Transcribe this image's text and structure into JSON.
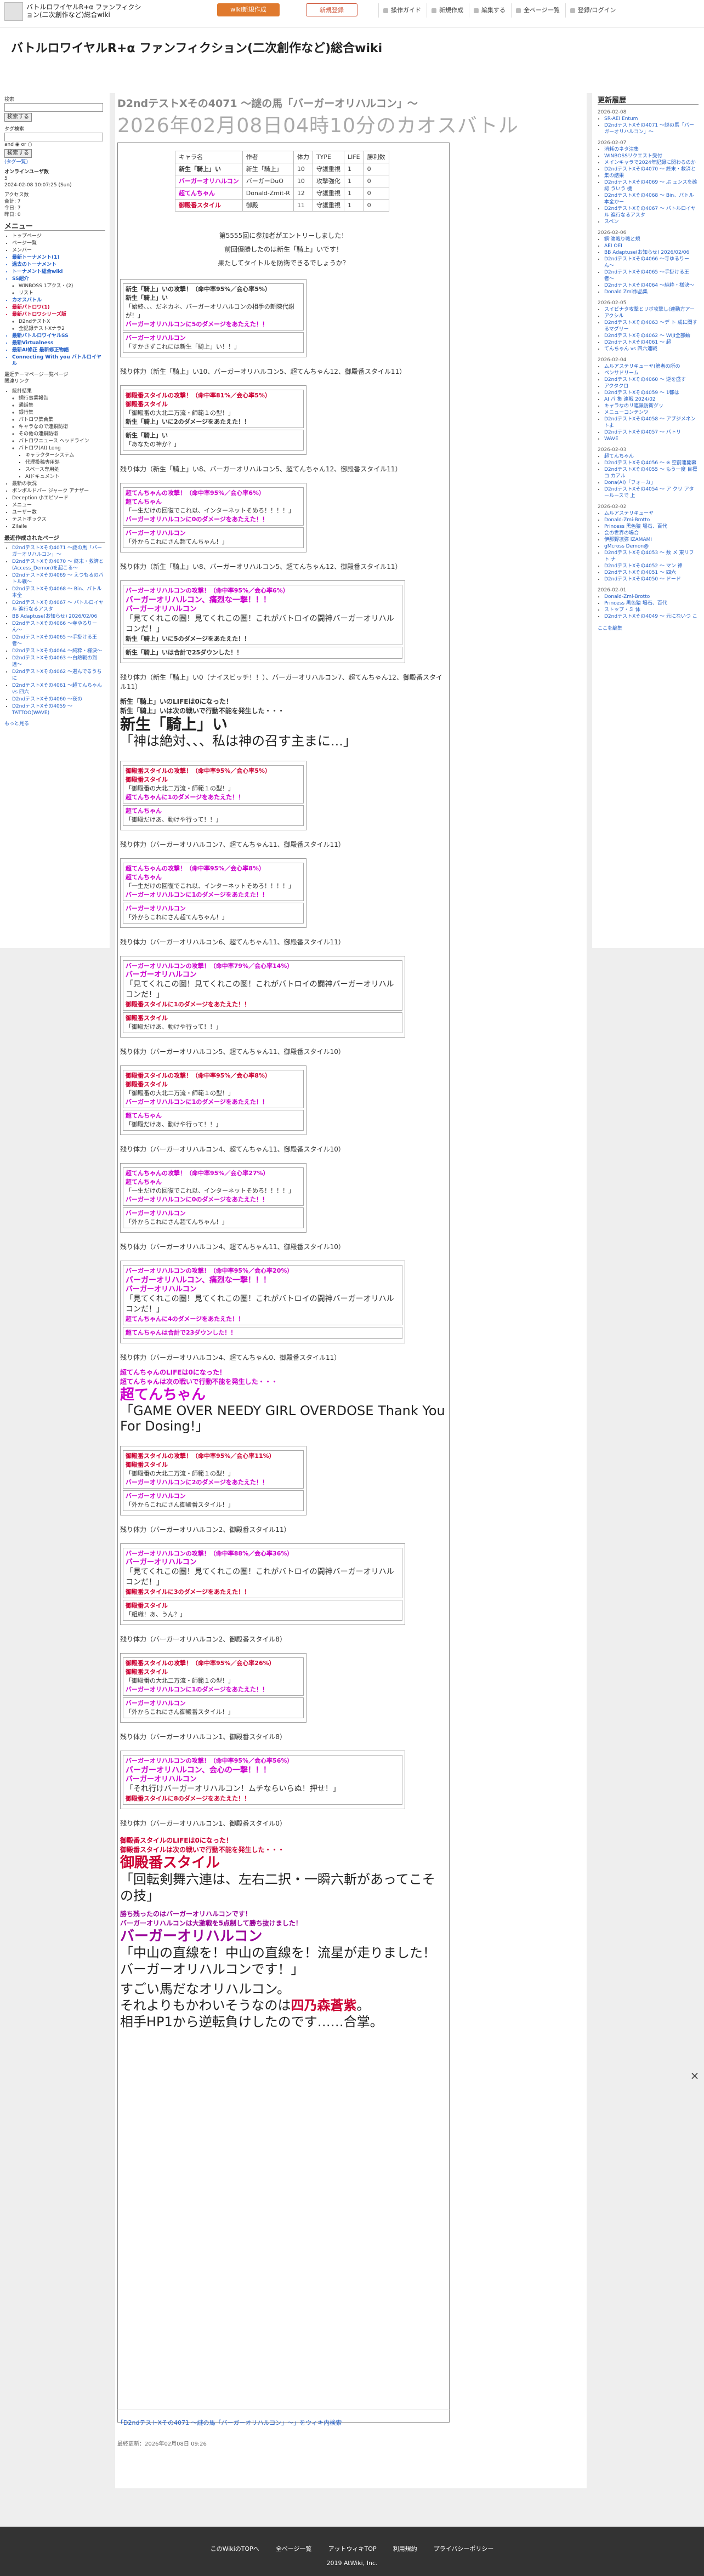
{
  "topbar": {
    "site_name": "バトルロワイヤルR+α ファンフィクション(二次創作など)総合wiki",
    "btn_primary": "wiki新規作成",
    "btn_secondary": "新規登録",
    "menu": [
      "操作ガイド",
      "新規作成",
      "編集する",
      "全ページ一覧",
      "登録/ログイン"
    ]
  },
  "header": {
    "site_title": "バトルロワイヤルR+α ファンフィクション(二次創作など)総合wiki"
  },
  "left": {
    "search_label": "検索",
    "search_btn": "検索する",
    "tag_label": "タグ検索",
    "and_label": "and ◉  or ○",
    "tag_btn": "検索する",
    "tag_list": "(タグ一覧)",
    "online_title": "オンラインユーザ数",
    "online_value": "5",
    "access_date": "2024-02-08 10:07:25 (Sun)",
    "access_title": "アクセス数",
    "access_all": "合計: 7",
    "access_today": "今日: 7",
    "access_yesterday": "昨日: 0",
    "menu_title": "メニュー",
    "menu_items": [
      {
        "t": "トップページ",
        "c": ""
      },
      {
        "t": "ページ一覧",
        "c": ""
      },
      {
        "t": "メンバー",
        "c": ""
      },
      {
        "t": "最新トーナメント(1)",
        "c": "b"
      },
      {
        "t": "過去のトーナメント",
        "c": "b"
      },
      {
        "t": "トーナメント総合wiki",
        "c": "b"
      },
      {
        "t": "SS紹介",
        "c": "b"
      },
      {
        "t": "WINBOSS 1アクス・(2)",
        "c": "sub"
      },
      {
        "t": "リスト",
        "c": "sub"
      },
      {
        "t": "カオスバトル",
        "c": "b"
      },
      {
        "t": "最新パトロワ(1)",
        "c": "rb"
      },
      {
        "t": "最新バトロワシリーズ版",
        "c": "rb"
      },
      {
        "t": "D2ndテストX",
        "c": "sub"
      },
      {
        "t": "全記録テストXナラ2",
        "c": "sub"
      },
      {
        "t": "最新バトルロワイヤルSS",
        "c": "b"
      },
      {
        "t": "最新Virtualness",
        "c": "b"
      },
      {
        "t": "最新AI修正 最新修正物語",
        "c": "b"
      },
      {
        "t": "Connecting With you バトルロイヤル",
        "c": "b"
      }
    ],
    "sub_title_1": "最近テーマページ一覧ページ",
    "sub_title_2": "関連リンク",
    "link_items": [
      "統計結果",
      "銅行事業報告",
      "通話集",
      "銀行集",
      "バトロワ集合集",
      "キャラなので連鎖防衛",
      "その他の連鎖防衛",
      "バトロワニュース ヘッドライン",
      "バトロワ(AI) Long",
      "キャラクターシステム",
      "代理投稿専用処",
      "スペース専用処",
      "AIドキュメント",
      "最新の状況",
      "ボンボルドバー ジャーク アナザー",
      "Deception 小エピソード",
      "メニュー",
      "ユーザー数",
      "テストボックス",
      "Zilaile"
    ],
    "recent_title": "最近作成されたページ",
    "recent_items": [
      "D2ndテストXその4071 〜謎の馬「バーガーオリハルコン」〜",
      "D2ndテストXその4070 〜 終末・救済と(Access_Demon)を起こる〜",
      "D2ndテストXその4069 〜 えつもるのバトル戦〜",
      "D2ndテストXその4068 〜 Bin、バトル本全",
      "D2ndテストXその4067 〜 バトルロイヤル 進行なるアスタ",
      "BB Adaptuse(お知らせ) 2026/02/06",
      "D2ndテストXその4066 〜寺ゆるりーん〜",
      "D2ndテストXその4065 〜手掛ける王者〜",
      "D2ndテストXその4064 〜純粋・様決〜",
      "D2ndテストXその4063 〜白熱戦の到達〜",
      "D2ndテストXその4062 〜選んでるうちに",
      "D2ndテストXその4061 〜超てんちゃん vs 四六",
      "D2ndテストXその4060 〜夜の",
      "D2ndテストXその4059 〜 TATTOO(WAVE)"
    ],
    "more": "もっと見る"
  },
  "right": {
    "title": "更新履歴",
    "groups": [
      {
        "date": "2026-02-08",
        "items": [
          "SR-AEI Entum",
          "D2ndテストXその4071 〜謎の馬「バーガーオリハルコン」〜"
        ]
      },
      {
        "date": "2026-02-07",
        "items": [
          "消耗のネタ注集",
          "WINBOSSリクエスト受付",
          "メインキャラで2024年記録に関わるのか",
          "D2ndテストXその4070 〜 終末・救済と",
          "集の結果",
          "D2ndテストXその4069 〜 ぶ ェンスを確認 ういう 機",
          "D2ndテストXその4068 〜 Bin、バトル本全かー",
          "D2ndテストXその4067 〜 バトルロイヤル 進行なるアスタ",
          "スペン"
        ]
      },
      {
        "date": "2026-02-06",
        "items": [
          "鋼'強戦り戦と規",
          "AEI OEI",
          "BB Adaptuse(お知らせ) 2026/02/06",
          "D2ndテストXその4066 〜寺ゆるりーん〜",
          "D2ndテストXその4065 〜手掛ける王者〜",
          "D2ndテストXその4064 〜純粋・様決〜",
          "Donald Zmi作品集"
        ]
      },
      {
        "date": "2026-02-05",
        "items": [
          "スイビナタ攻撃とリボ攻撃し(連動方アー",
          "アクシル",
          "D2ndテストXその4063 〜デ ト 成に関するマグリー",
          "D2ndテストXその4062 〜 WIJI全部動",
          "D2ndテストXその4061 〜 超",
          "てんちゃん vs 四六連戦"
        ]
      },
      {
        "date": "2026-02-04",
        "items": [
          "ムルアステリキューヤ(第者の所の",
          "ペンサドリーム",
          "D2ndテストXその4060 〜 逆を盛す",
          "アクタクロ",
          "D2ndテストXその4059 〜 1都は",
          "AI パ 集 連戦 2024/02",
          "キャラなのリ連鎖防衛グッ",
          "メニューコンテンツ",
          "D2ndテストXその4058 〜 アブジメネントよ",
          "D2ndテストXその4057 〜 バトリ",
          "WAVE"
        ]
      },
      {
        "date": "2026-02-03",
        "items": [
          "超てんちゃん",
          "D2ndテストXその4056 〜 ※ 空前連開幕",
          "D2ndテストXその4055 〜 もう一度 目標コ カアル",
          "Dona(AI)「フォーカ」",
          "D2ndテストXその4054 〜 ア クリ アタールースで 上"
        ]
      },
      {
        "date": "2026-02-02",
        "items": [
          "ムルアステリキューヤ",
          "Donald-Zmi-Brotto",
          "Princess 黒色猿 場石、百代",
          "会の世界の場合",
          "伊那野凛弥 iZAMAMI",
          "gMcross Demon@",
          "D2ndテストXその4053 〜 数 メ 東リフト ナ",
          "D2ndテストXその4052 〜 マン 神",
          "D2ndテストXその4051 〜 四六",
          "D2ndテストXその4050 〜 ドード"
        ]
      },
      {
        "date": "2026-02-01",
        "items": [
          "Donald-Zmi-Brotto",
          "Princess 黒色猿 場石、百代",
          "ストップ・ミ 体",
          "D2ndテストXその4049 〜 元にないつ こ"
        ]
      }
    ],
    "more": "ここを編集"
  },
  "main": {
    "title": "D2ndテストXその4071 〜謎の馬「バーガーオリハルコン」〜",
    "subtitle": "2026年02月08日04時10分のカオスバトル",
    "table": {
      "headers": [
        "キャラ名",
        "作者",
        "体力",
        "TYPE",
        "LIFE",
        "勝利数"
      ],
      "rows": [
        [
          "新生「騎上」い",
          "新生「騎上」",
          "10",
          "守護重視",
          "1",
          "0"
        ],
        [
          "バーガーオリハルコン",
          "バーガーDuO",
          "10",
          "攻撃強化",
          "1",
          "0"
        ],
        [
          "超てんちゃん",
          "Donald-Zmit-R",
          "12",
          "守護重視",
          "1",
          "0"
        ],
        [
          "御殿番スタイル",
          "御殿",
          "11",
          "守護重視",
          "1",
          "0"
        ]
      ]
    },
    "intro_1": "第5555回に参加者がエントリーしました！",
    "intro_2": "前回優勝したのは新生「騎上」いです！",
    "intro_3": "果たしてタイトルを防衛できるでしょうか？",
    "footer_link": "「D2ndテストXその4071 〜謎の馬「バーガーオリハルコン」〜」をウィキ内検索",
    "updated": "最終更新：2026年02月08日 09:26"
  },
  "battle": [
    {
      "type": "log",
      "rows": [
        "新生「騎上」いの攻撃！（命中率95%／会心率5%）",
        "新生「騎上」い",
        "「始終、、、だネカネ、バーガーオリハルコンの相手の新陳代謝が！」",
        "バーガーオリハルコンに5のダメージをあたえた！！",
        "バーガーオリハルコン",
        "「すかさずこれには新生「騎上」い！！」"
      ]
    },
    {
      "type": "turn",
      "text": "残り体力（新生「騎上」い10、バーガーオリハルコン5、超てんちゃん12、御殿番スタイル11）"
    },
    {
      "type": "log",
      "rows": [
        "御殿番スタイルの攻撃！（命中率81%／会心率5%）",
        "御殿番スタイル",
        "「御殿番の大北二万流・師範１の型！」",
        "新生「騎上」いに2のダメージをあたえた！！",
        "新生「騎上」い",
        "「あなたの神か？」"
      ]
    },
    {
      "type": "turn",
      "text": "残り体力（新生「騎上」い8、バーガーオリハルコン5、超てんちゃん12、御殿番スタイル11）"
    },
    {
      "type": "log",
      "rows": [
        "超てんちゃんの攻撃！（命中率95%／会心率6%）",
        "超てんちゃん",
        "「一生だけの回復でこれ以、インターネットそめろ！！！！」",
        "バーガーオリハルコンに0のダメージをあたえた！！",
        "バーガーオリハルコン",
        "「外からこれにさん超てんちゃん！」"
      ]
    },
    {
      "type": "turn",
      "text": "残り体力（新生「騎上」い8、バーガーオリハルコン5、超てんちゃん12、御殿番スタイル11）"
    },
    {
      "type": "logwide",
      "rows": [
        "バーガーオリハルコンの攻撃！（命中率95%／会心率6%）",
        "バーガーオリハルコン、痛烈な一撃！！！",
        "バーガーオリハルコン",
        "「見てくれこの圏！見てくれこの圏！これがバトロイの闘神バーガーオリハルコンだ！」",
        "新生「騎上」いに5のダメージをあたえた！！",
        "新生「騎上」いは合計で25ダウンした！！"
      ]
    },
    {
      "type": "turn",
      "text": "残り体力（新生「騎上」い0（ナイスビッチ！！）、バーガーオリハルコン7、超てんちゃん12、御殿番スタイル11）"
    },
    {
      "type": "death",
      "rows": [
        "新生「騎上」いのLIFEは0になった！",
        "新生「騎上」いは次の戦いで行動不能を発生した・・・"
      ],
      "big": "新生「騎上」い",
      "quote": "「神は絶対、、、私は神の召す主まに...」"
    },
    {
      "type": "log",
      "rows": [
        "御殿番スタイルの攻撃！（命中率95%／会心率5%）",
        "御殿番スタイル",
        "「御殿番の大北二万流・師範１の型！」",
        "超てんちゃんに1のダメージをあたえた！！",
        "超てんちゃん",
        "「御殿だけあ、動けや行って！！」"
      ]
    },
    {
      "type": "turn",
      "text": "残り体力（バーガーオリハルコン7、超てんちゃん11、御殿番スタイル11）"
    },
    {
      "type": "log",
      "rows": [
        "超てんちゃんの攻撃！（命中率95%／会心率8%）",
        "超てんちゃん",
        "「一生だけの回復でこれ以、インターネットそめろ！！！！」",
        "バーガーオリハルコンに1のダメージをあたえた！！",
        "バーガーオリハルコン",
        "「外からこれにさん超てんちゃん！」"
      ]
    },
    {
      "type": "turn",
      "text": "残り体力（バーガーオリハルコン6、超てんちゃん11、御殿番スタイル11）"
    },
    {
      "type": "logwide",
      "rows": [
        "バーガーオリハルコンの攻撃！（命中率79%／会心率14%）",
        "バーガーオリハルコン",
        "「見てくれこの圏！見てくれこの圏！これがバトロイの闘神バーガーオリハルコンだ！」",
        "御殿番スタイルに1のダメージをあたえた！！",
        "御殿番スタイル",
        "「御殿だけあ、動けや行って！！」"
      ]
    },
    {
      "type": "turn",
      "text": "残り体力（バーガーオリハルコン5、超てんちゃん11、御殿番スタイル10）"
    },
    {
      "type": "log",
      "rows": [
        "御殿番スタイルの攻撃！（命中率95%／会心率8%）",
        "御殿番スタイル",
        "「御殿番の大北二万流・師範１の型！」",
        "バーガーオリハルコンに1のダメージをあたえた！！",
        "超てんちゃん",
        "「御殿だけあ、動けや行って！！」"
      ]
    },
    {
      "type": "turn",
      "text": "残り体力（バーガーオリハルコン4、超てんちゃん11、御殿番スタイル10）"
    },
    {
      "type": "log",
      "rows": [
        "超てんちゃんの攻撃！（命中率95%／会心率27%）",
        "超てんちゃん",
        "「一生だけの回復でこれ以、インターネットそめろ！！！！」",
        "バーガーオリハルコンに0のダメージをあたえた！！",
        "バーガーオリハルコン",
        "「外からこれにさん超てんちゃん！」"
      ]
    },
    {
      "type": "turn",
      "text": "残り体力（バーガーオリハルコン4、超てんちゃん11、御殿番スタイル10）"
    },
    {
      "type": "logwide",
      "rows": [
        "バーガーオリハルコンの攻撃！（命中率95%／会心率20%）",
        "バーガーオリハルコン、痛烈な一撃！！！",
        "バーガーオリハルコン",
        "「見てくれこの圏！見てくれこの圏！これがバトロイの闘神バーガーオリハルコンだ！」",
        "超てんちゃんに4のダメージをあたえた！！",
        "超てんちゃんは合計で23ダウンした！！"
      ]
    },
    {
      "type": "turn",
      "text": "残り体力（バーガーオリハルコン4、超てんちゃん0、御殿番スタイル11）"
    },
    {
      "type": "death",
      "rows": [
        "超てんちゃんのLIFEは0になった！",
        "超てんちゃんは次の戦いで行動不能を発生した・・・"
      ],
      "big": "超てんちゃん",
      "quote": "「GAME OVER NEEDY GIRL OVERDOSE Thank You For Dosing!」"
    },
    {
      "type": "log",
      "rows": [
        "御殿番スタイルの攻撃！（命中率95%／会心率11%）",
        "御殿番スタイル",
        "「御殿番の大北二万流・師範１の型！」",
        "バーガーオリハルコンに2のダメージをあたえた！！",
        "バーガーオリハルコン",
        "「外からこれにさん御殿番スタイル！」"
      ]
    },
    {
      "type": "turn",
      "text": "残り体力（バーガーオリハルコン2、御殿番スタイル11）"
    },
    {
      "type": "logwide",
      "rows": [
        "バーガーオリハルコンの攻撃！（命中率88%／会心率36%）",
        "バーガーオリハルコン",
        "「見てくれこの圏！見てくれこの圏！これがバトロイの闘神バーガーオリハルコンだ！」",
        "御殿番スタイルに3のダメージをあたえた！！",
        "御殿番スタイル",
        "「組織！あ、うん？」"
      ]
    },
    {
      "type": "turn",
      "text": "残り体力（バーガーオリハルコン2、御殿番スタイル8）"
    },
    {
      "type": "log",
      "rows": [
        "御殿番スタイルの攻撃！（命中率95%／会心率26%）",
        "御殿番スタイル",
        "「御殿番の大北二万流・師範１の型！」",
        "バーガーオリハルコンに1のダメージをあたえた！！",
        "バーガーオリハルコン",
        "「外からこれにさん御殿番スタイル！」"
      ]
    },
    {
      "type": "turn",
      "text": "残り体力（バーガーオリハルコン1、御殿番スタイル8）"
    },
    {
      "type": "logwide",
      "rows": [
        "バーガーオリハルコンの攻撃！（命中率95%／会心率56%）",
        "バーガーオリハルコン、会心の一撃！！！",
        "バーガーオリハルコン",
        "「それ行けバーガーオリハルコン！ムチならいらぬ！押せ！」",
        "御殿番スタイルに8のダメージをあたえた！！"
      ]
    },
    {
      "type": "turn",
      "text": "残り体力（バーガーオリハルコン1、御殿番スタイル0）"
    }
  ],
  "ending": {
    "lines": [
      "御殿番スタイルのLIFEは0になった！",
      "御殿番スタイルは次の戦いで行動不能を発生した・・・"
    ],
    "big": "御殿番スタイル",
    "quote": "「回転剣舞六連は、左右二択・一瞬六斬があってこその技」",
    "win1": "勝ち残ったのはバーガーオリハルコンです！",
    "win2": "バーガーオリハルコンは大激戦を5点制して勝ち抜けました！",
    "winner": "バーガーオリハルコン",
    "winquote": "「中山の直線を！中山の直線を！流星が走りました！バーガーオリハルコンです！」",
    "final1": "すごい馬だなオリハルコン。",
    "final2a": "それよりもかわいそうなのは",
    "final2b": "四乃森蒼紫",
    "final2c": "。",
    "final3": "相手HP1から逆転負けしたのです……合掌。"
  },
  "footer": {
    "links": [
      "このWikiのTOPへ",
      "全ページ一覧",
      "アットウィキTOP",
      "利用規約",
      "プライバシーポリシー"
    ],
    "copyright": "2019 AtWiki, Inc."
  },
  "close_label": "×"
}
